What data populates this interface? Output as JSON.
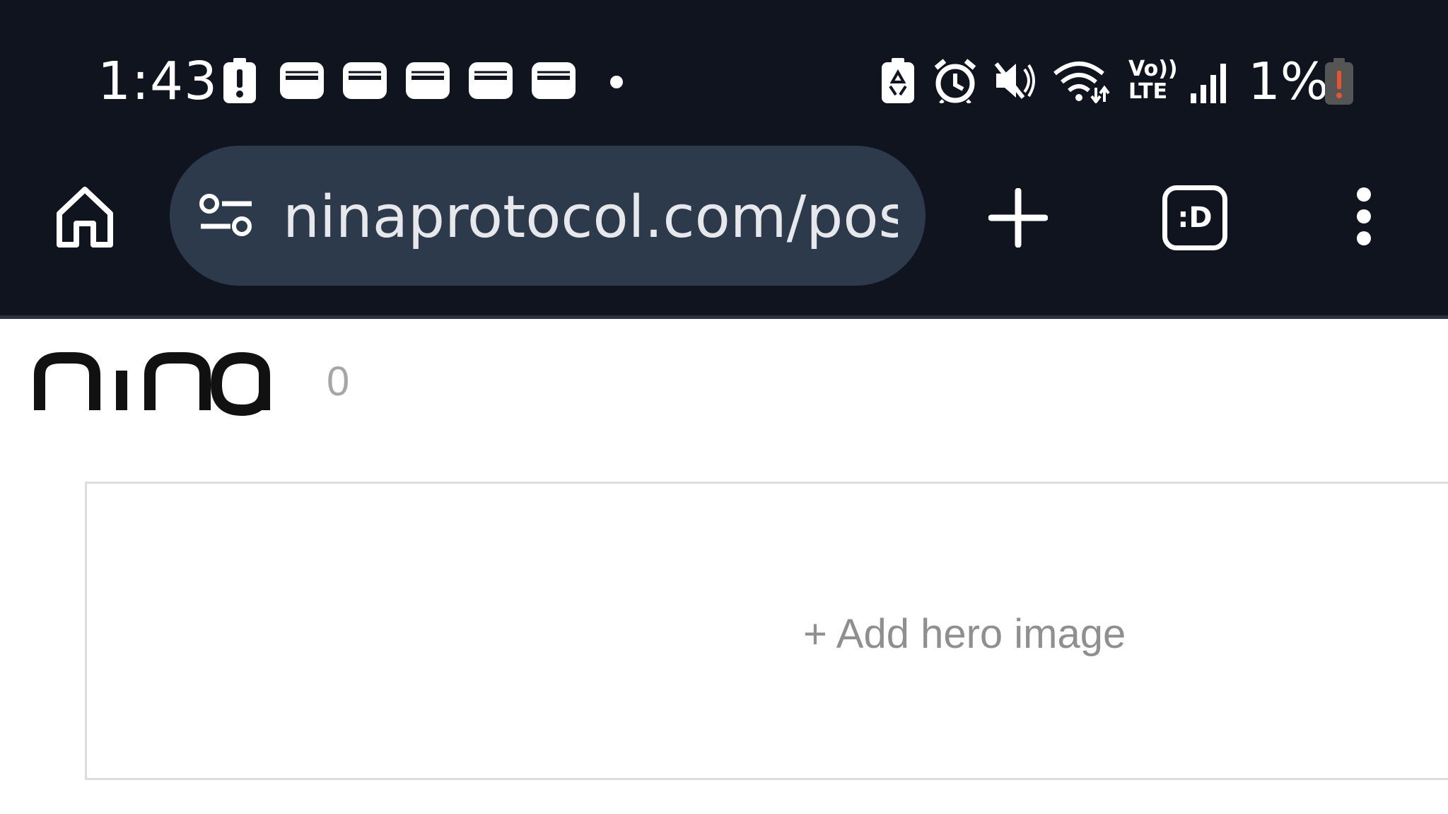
{
  "status_bar": {
    "time": "1:43",
    "battery_percent": "1%",
    "icons": [
      "battery-alert-icon",
      "wallet-icon",
      "wallet-icon",
      "wallet-icon",
      "wallet-icon",
      "wallet-icon",
      "dot-icon",
      "battery-saver-icon",
      "alarm-icon",
      "mute-icon",
      "wifi-icon",
      "volte-icon",
      "signal-icon",
      "battery-low-icon"
    ],
    "network_label_top": "Vo))",
    "network_label_bottom": "LTE"
  },
  "browser": {
    "url": "ninaprotocol.com/post",
    "tab_icon_label": ":D"
  },
  "page": {
    "logo_text": "nina",
    "counter": "0",
    "hero_placeholder": "+ Add hero image"
  },
  "colors": {
    "top_bar": "#0f141e",
    "url_bar": "#2d3a4c",
    "battery_alert": "#e8542f"
  }
}
